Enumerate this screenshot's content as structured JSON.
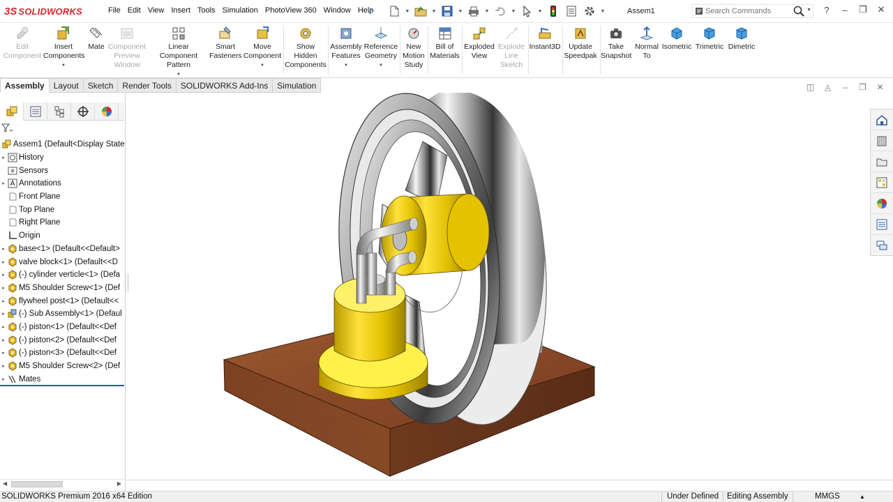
{
  "app": {
    "logo_mark": "3S",
    "brand": "SOLIDWORKS",
    "document_title": "Assem1"
  },
  "menu": [
    "File",
    "Edit",
    "View",
    "Insert",
    "Tools",
    "Simulation",
    "PhotoView 360",
    "Window",
    "Help"
  ],
  "search": {
    "placeholder": "Search Commands"
  },
  "commands": [
    {
      "label": "Edit\nComponent",
      "icon": "edit-component-icon",
      "disabled": true
    },
    {
      "label": "Insert\nComponents",
      "icon": "insert-components-icon",
      "disabled": false,
      "dropdown": true
    },
    {
      "label": "Mate",
      "icon": "mate-icon",
      "disabled": false
    },
    {
      "label": "Component\nPreview\nWindow",
      "icon": "component-preview-icon",
      "disabled": true
    },
    {
      "label": "Linear Component\nPattern",
      "icon": "linear-pattern-icon",
      "disabled": false,
      "dropdown": true
    },
    {
      "label": "Smart\nFasteners",
      "icon": "smart-fasteners-icon",
      "disabled": false
    },
    {
      "label": "Move\nComponent",
      "icon": "move-component-icon",
      "disabled": false,
      "dropdown": true
    },
    {
      "label": "Show\nHidden\nComponents",
      "icon": "show-hidden-icon",
      "disabled": false
    },
    {
      "label": "Assembly\nFeatures",
      "icon": "assembly-features-icon",
      "disabled": false,
      "dropdown": true
    },
    {
      "label": "Reference\nGeometry",
      "icon": "reference-geometry-icon",
      "disabled": false,
      "dropdown": true
    },
    {
      "label": "New\nMotion\nStudy",
      "icon": "motion-study-icon",
      "disabled": false
    },
    {
      "label": "Bill of\nMaterials",
      "icon": "bom-icon",
      "disabled": false
    },
    {
      "label": "Exploded\nView",
      "icon": "exploded-view-icon",
      "disabled": false
    },
    {
      "label": "Explode\nLine\nSketch",
      "icon": "explode-line-icon",
      "disabled": true
    },
    {
      "label": "Instant3D",
      "icon": "instant3d-icon",
      "disabled": false
    },
    {
      "label": "Update\nSpeedpak",
      "icon": "speedpak-icon",
      "disabled": false
    },
    {
      "label": "Take\nSnapshot",
      "icon": "camera-icon",
      "disabled": false
    },
    {
      "label": "Normal\nTo",
      "icon": "normal-to-icon",
      "disabled": false
    },
    {
      "label": "Isometric",
      "icon": "isometric-icon",
      "disabled": false
    },
    {
      "label": "Trimetric",
      "icon": "trimetric-icon",
      "disabled": false
    },
    {
      "label": "Dimetric",
      "icon": "dimetric-icon",
      "disabled": false
    }
  ],
  "tabs": [
    {
      "label": "Assembly",
      "active": true
    },
    {
      "label": "Layout",
      "active": false
    },
    {
      "label": "Sketch",
      "active": false
    },
    {
      "label": "Render Tools",
      "active": false
    },
    {
      "label": "SOLIDWORKS Add-Ins",
      "active": false
    },
    {
      "label": "Simulation",
      "active": false
    }
  ],
  "tree": [
    {
      "label": "Assem1  (Default<Display State-",
      "icon": "assembly-icon",
      "expand": false,
      "root": true
    },
    {
      "label": "History",
      "icon": "history-icon",
      "expand": true
    },
    {
      "label": "Sensors",
      "icon": "sensors-icon",
      "expand": false
    },
    {
      "label": "Annotations",
      "icon": "annotations-icon",
      "expand": true
    },
    {
      "label": "Front Plane",
      "icon": "plane-icon",
      "expand": false
    },
    {
      "label": "Top Plane",
      "icon": "plane-icon",
      "expand": false
    },
    {
      "label": "Right Plane",
      "icon": "plane-icon",
      "expand": false
    },
    {
      "label": "Origin",
      "icon": "origin-icon",
      "expand": false
    },
    {
      "label": "base<1> (Default<<Default>",
      "icon": "part-icon",
      "expand": true
    },
    {
      "label": "valve block<1> (Default<<D",
      "icon": "part-icon",
      "expand": true
    },
    {
      "label": "(-) cylinder verticle<1> (Defa",
      "icon": "part-icon",
      "expand": true
    },
    {
      "label": "M5 Shoulder Screw<1> (Def",
      "icon": "part-icon",
      "expand": true
    },
    {
      "label": "flywheel post<1> (Default<<",
      "icon": "part-icon",
      "expand": true
    },
    {
      "label": "(-) Sub Assembly<1> (Defaul",
      "icon": "subassembly-icon",
      "expand": true
    },
    {
      "label": "(-) piston<1> (Default<<Def",
      "icon": "part-icon",
      "expand": true
    },
    {
      "label": "(-) piston<2> (Default<<Def",
      "icon": "part-icon",
      "expand": true
    },
    {
      "label": "(-) piston<3> (Default<<Def",
      "icon": "part-icon",
      "expand": true
    },
    {
      "label": "M5 Shoulder Screw<2> (Def",
      "icon": "part-icon",
      "expand": true
    },
    {
      "label": "Mates",
      "icon": "mates-icon",
      "expand": true
    }
  ],
  "status": {
    "edition": "SOLIDWORKS Premium 2016 x64 Edition",
    "definition": "Under Defined",
    "mode": "Editing Assembly",
    "units": "MMGS"
  },
  "colors": {
    "brand_red": "#d8262f",
    "wood": "#8a4a2a",
    "brass": "#e3c300",
    "steel": "#c8c8c8",
    "accent_blue": "#2a5aa8"
  }
}
